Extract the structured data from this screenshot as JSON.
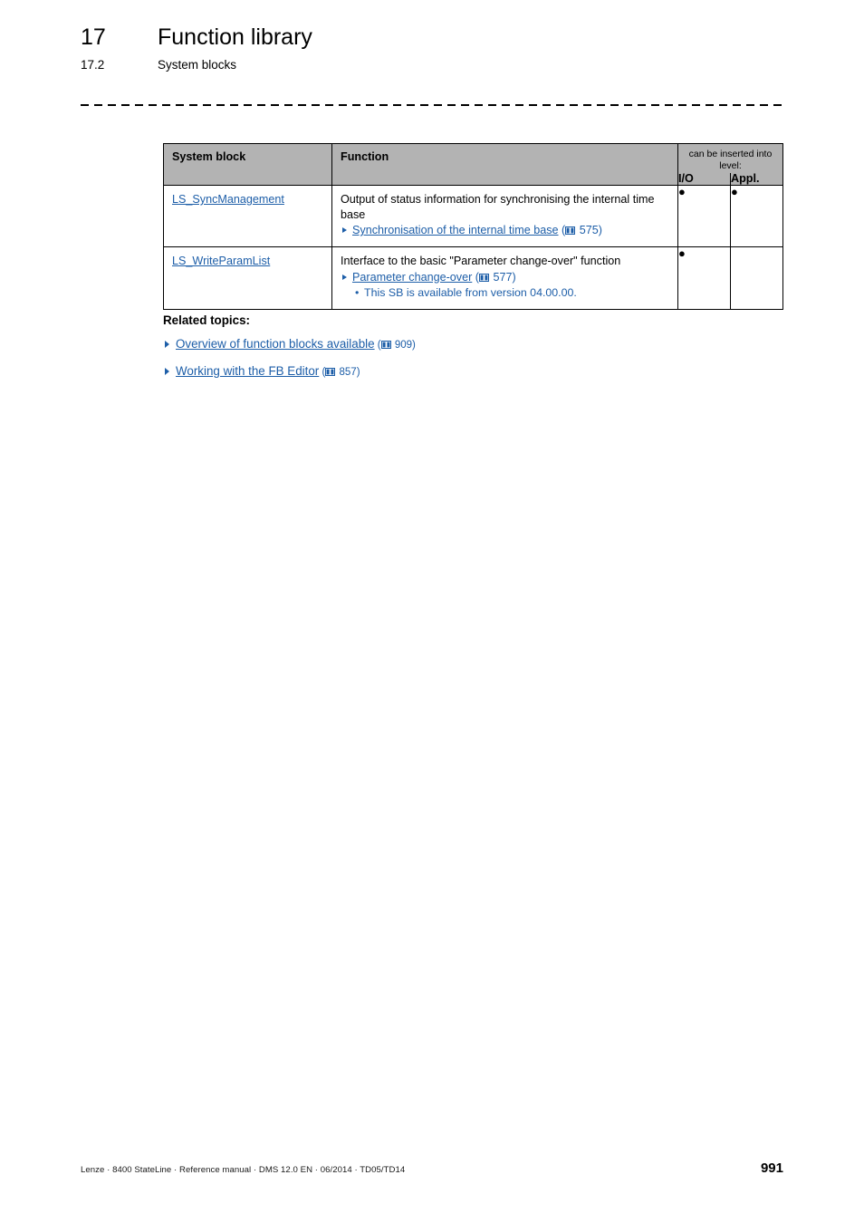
{
  "header": {
    "chapter_number": "17",
    "chapter_title": "Function library",
    "section_number": "17.2",
    "section_title": "System blocks"
  },
  "table": {
    "columns": {
      "system_block": "System block",
      "function": "Function",
      "level_group": "can be inserted into level:",
      "io": "I/O",
      "appl": "Appl."
    },
    "rows": [
      {
        "system_block": "LS_SyncManagement",
        "function_text": "Output of status information for synchronising the internal time base",
        "xref_label": "Synchronisation of the internal time base",
        "xref_page": "575",
        "note": "",
        "io": "●",
        "appl": "●"
      },
      {
        "system_block": "LS_WriteParamList",
        "function_text": "Interface to the basic \"Parameter change-over\" function",
        "xref_label": "Parameter change-over",
        "xref_page": "577",
        "note": "This SB is available from version 04.00.00.",
        "io": "●",
        "appl": ""
      }
    ]
  },
  "related": {
    "heading": "Related topics:",
    "items": [
      {
        "label": "Overview of function blocks available",
        "page": "909"
      },
      {
        "label": "Working with the FB Editor",
        "page": "857"
      }
    ]
  },
  "footer": {
    "text": "Lenze · 8400 StateLine · Reference manual · DMS 12.0 EN · 06/2014 · TD05/TD14",
    "page_number": "991"
  },
  "colors": {
    "link": "#1d5ea8",
    "header_row_bg": "#b3b3b3",
    "rule": "#000000"
  }
}
